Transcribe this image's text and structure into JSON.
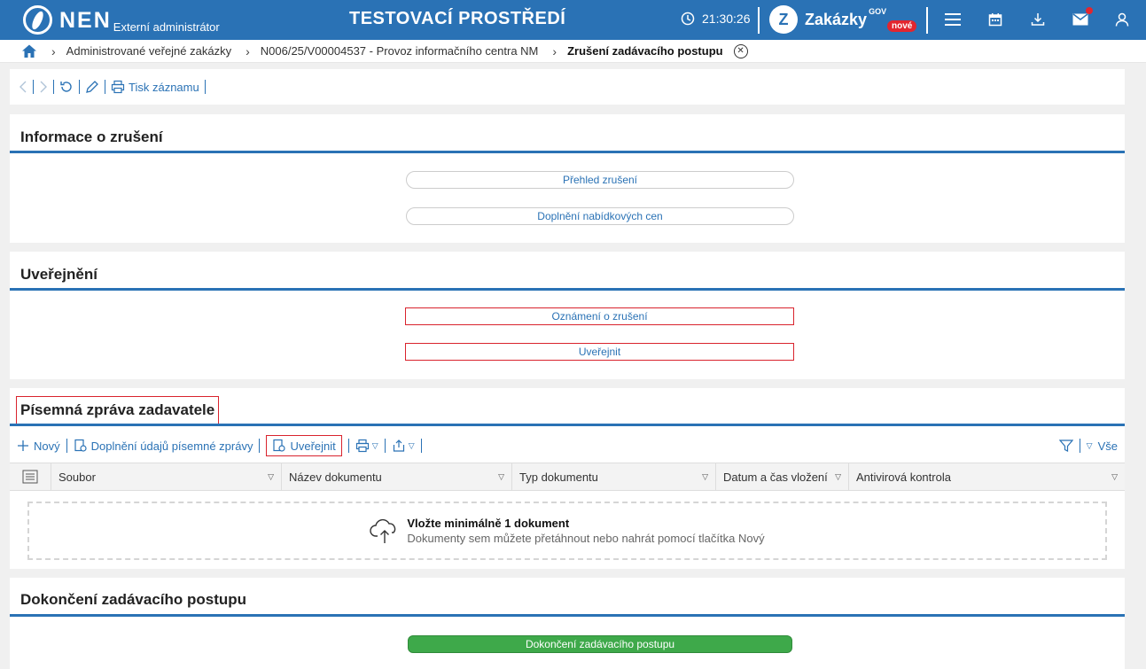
{
  "header": {
    "logo_text": "NEN",
    "logo_sub": "Externí administrátor",
    "env_title": "TESTOVACÍ PROSTŘEDÍ",
    "clock": "21:30:26",
    "zakazky_label": "Zakázky",
    "zakazky_gov": "GOV",
    "zakazky_badge": "nové",
    "colors": {
      "bar": "#2a72b5",
      "badge": "#e2262f"
    }
  },
  "breadcrumb": {
    "items": [
      "Administrované veřejné zakázky",
      "N006/25/V00004537 - Provoz informačního centra NM",
      "Zrušení zadávacího postupu"
    ]
  },
  "toolbar": {
    "print_label": "Tisk záznamu"
  },
  "sections": {
    "info": {
      "title": "Informace o zrušení",
      "buttons": [
        "Přehled zrušení",
        "Doplnění nabídkových cen"
      ]
    },
    "publish": {
      "title": "Uveřejnění",
      "buttons": [
        "Oznámení o zrušení",
        "Uveřejnit"
      ]
    },
    "report": {
      "title": "Písemná zpráva zadavatele",
      "toolbar": {
        "new_label": "Nový",
        "fill_label": "Doplnění údajů písemné zprávy",
        "publish_label": "Uveřejnit",
        "filter_all_label": "Vše"
      },
      "columns": [
        "Soubor",
        "Název dokumentu",
        "Typ dokumentu",
        "Datum a čas vložení",
        "Antivirová kontrola"
      ],
      "dropzone": {
        "title": "Vložte minimálně 1 dokument",
        "subtitle": "Dokumenty sem můžete přetáhnout nebo nahrát pomocí tlačítka Nový"
      }
    },
    "finish": {
      "title": "Dokončení zadávacího postupu",
      "button": "Dokončení zadávacího postupu"
    }
  }
}
